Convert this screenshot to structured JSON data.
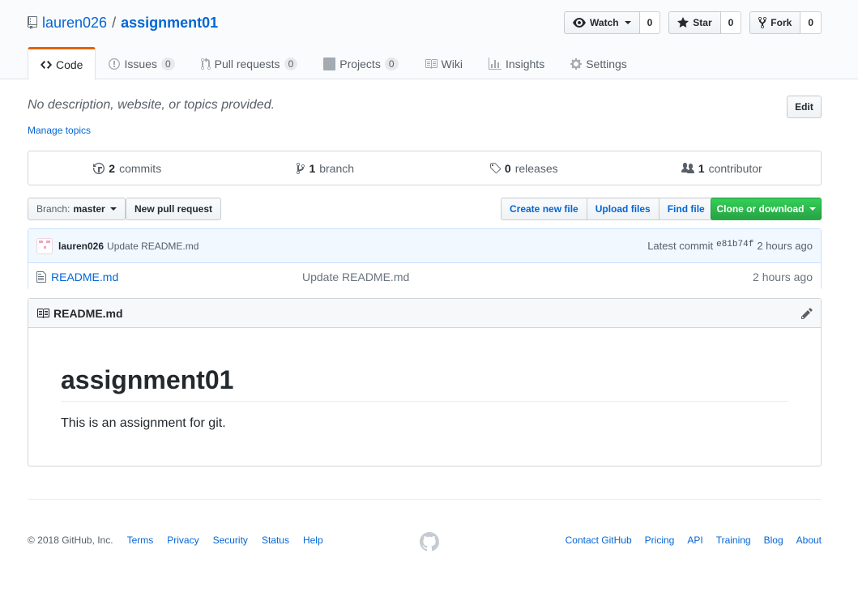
{
  "repo": {
    "owner": "lauren026",
    "separator": "/",
    "name": "assignment01"
  },
  "actions": {
    "watch": {
      "label": "Watch",
      "count": "0"
    },
    "star": {
      "label": "Star",
      "count": "0"
    },
    "fork": {
      "label": "Fork",
      "count": "0"
    }
  },
  "tabs": [
    {
      "label": "Code",
      "icon": "code-icon"
    },
    {
      "label": "Issues",
      "count": "0",
      "icon": "issue-icon"
    },
    {
      "label": "Pull requests",
      "count": "0",
      "icon": "pull-request-icon"
    },
    {
      "label": "Projects",
      "count": "0",
      "icon": "project-icon"
    },
    {
      "label": "Wiki",
      "icon": "book-icon"
    },
    {
      "label": "Insights",
      "icon": "graph-icon"
    },
    {
      "label": "Settings",
      "icon": "gear-icon"
    }
  ],
  "description": {
    "text": "No description, website, or topics provided.",
    "manage_topics": "Manage topics",
    "edit_label": "Edit"
  },
  "summary": {
    "commits": {
      "num": "2",
      "label": "commits"
    },
    "branch": {
      "num": "1",
      "label": "branch"
    },
    "releases": {
      "num": "0",
      "label": "releases"
    },
    "contributors": {
      "num": "1",
      "label": "contributor"
    }
  },
  "filenav": {
    "branch_label": "Branch:",
    "branch_value": "master",
    "new_pr": "New pull request",
    "create_file": "Create new file",
    "upload_files": "Upload files",
    "find_file": "Find file",
    "clone": "Clone or download"
  },
  "commit": {
    "author": "lauren026",
    "message": "Update README.md",
    "latest_label": "Latest commit",
    "sha": "e81b74f",
    "age": "2 hours ago"
  },
  "files": [
    {
      "name": "README.md",
      "message": "Update README.md",
      "age": "2 hours ago"
    }
  ],
  "readme": {
    "filename": "README.md",
    "heading": "assignment01",
    "body": "This is an assignment for git."
  },
  "footer": {
    "copyright": "© 2018 GitHub, Inc.",
    "left_links": [
      "Terms",
      "Privacy",
      "Security",
      "Status",
      "Help"
    ],
    "right_links": [
      "Contact GitHub",
      "Pricing",
      "API",
      "Training",
      "Blog",
      "About"
    ]
  },
  "colors": {
    "accent": "#0366d6",
    "tab_active": "#e36209",
    "clone_green": "#28a745"
  }
}
